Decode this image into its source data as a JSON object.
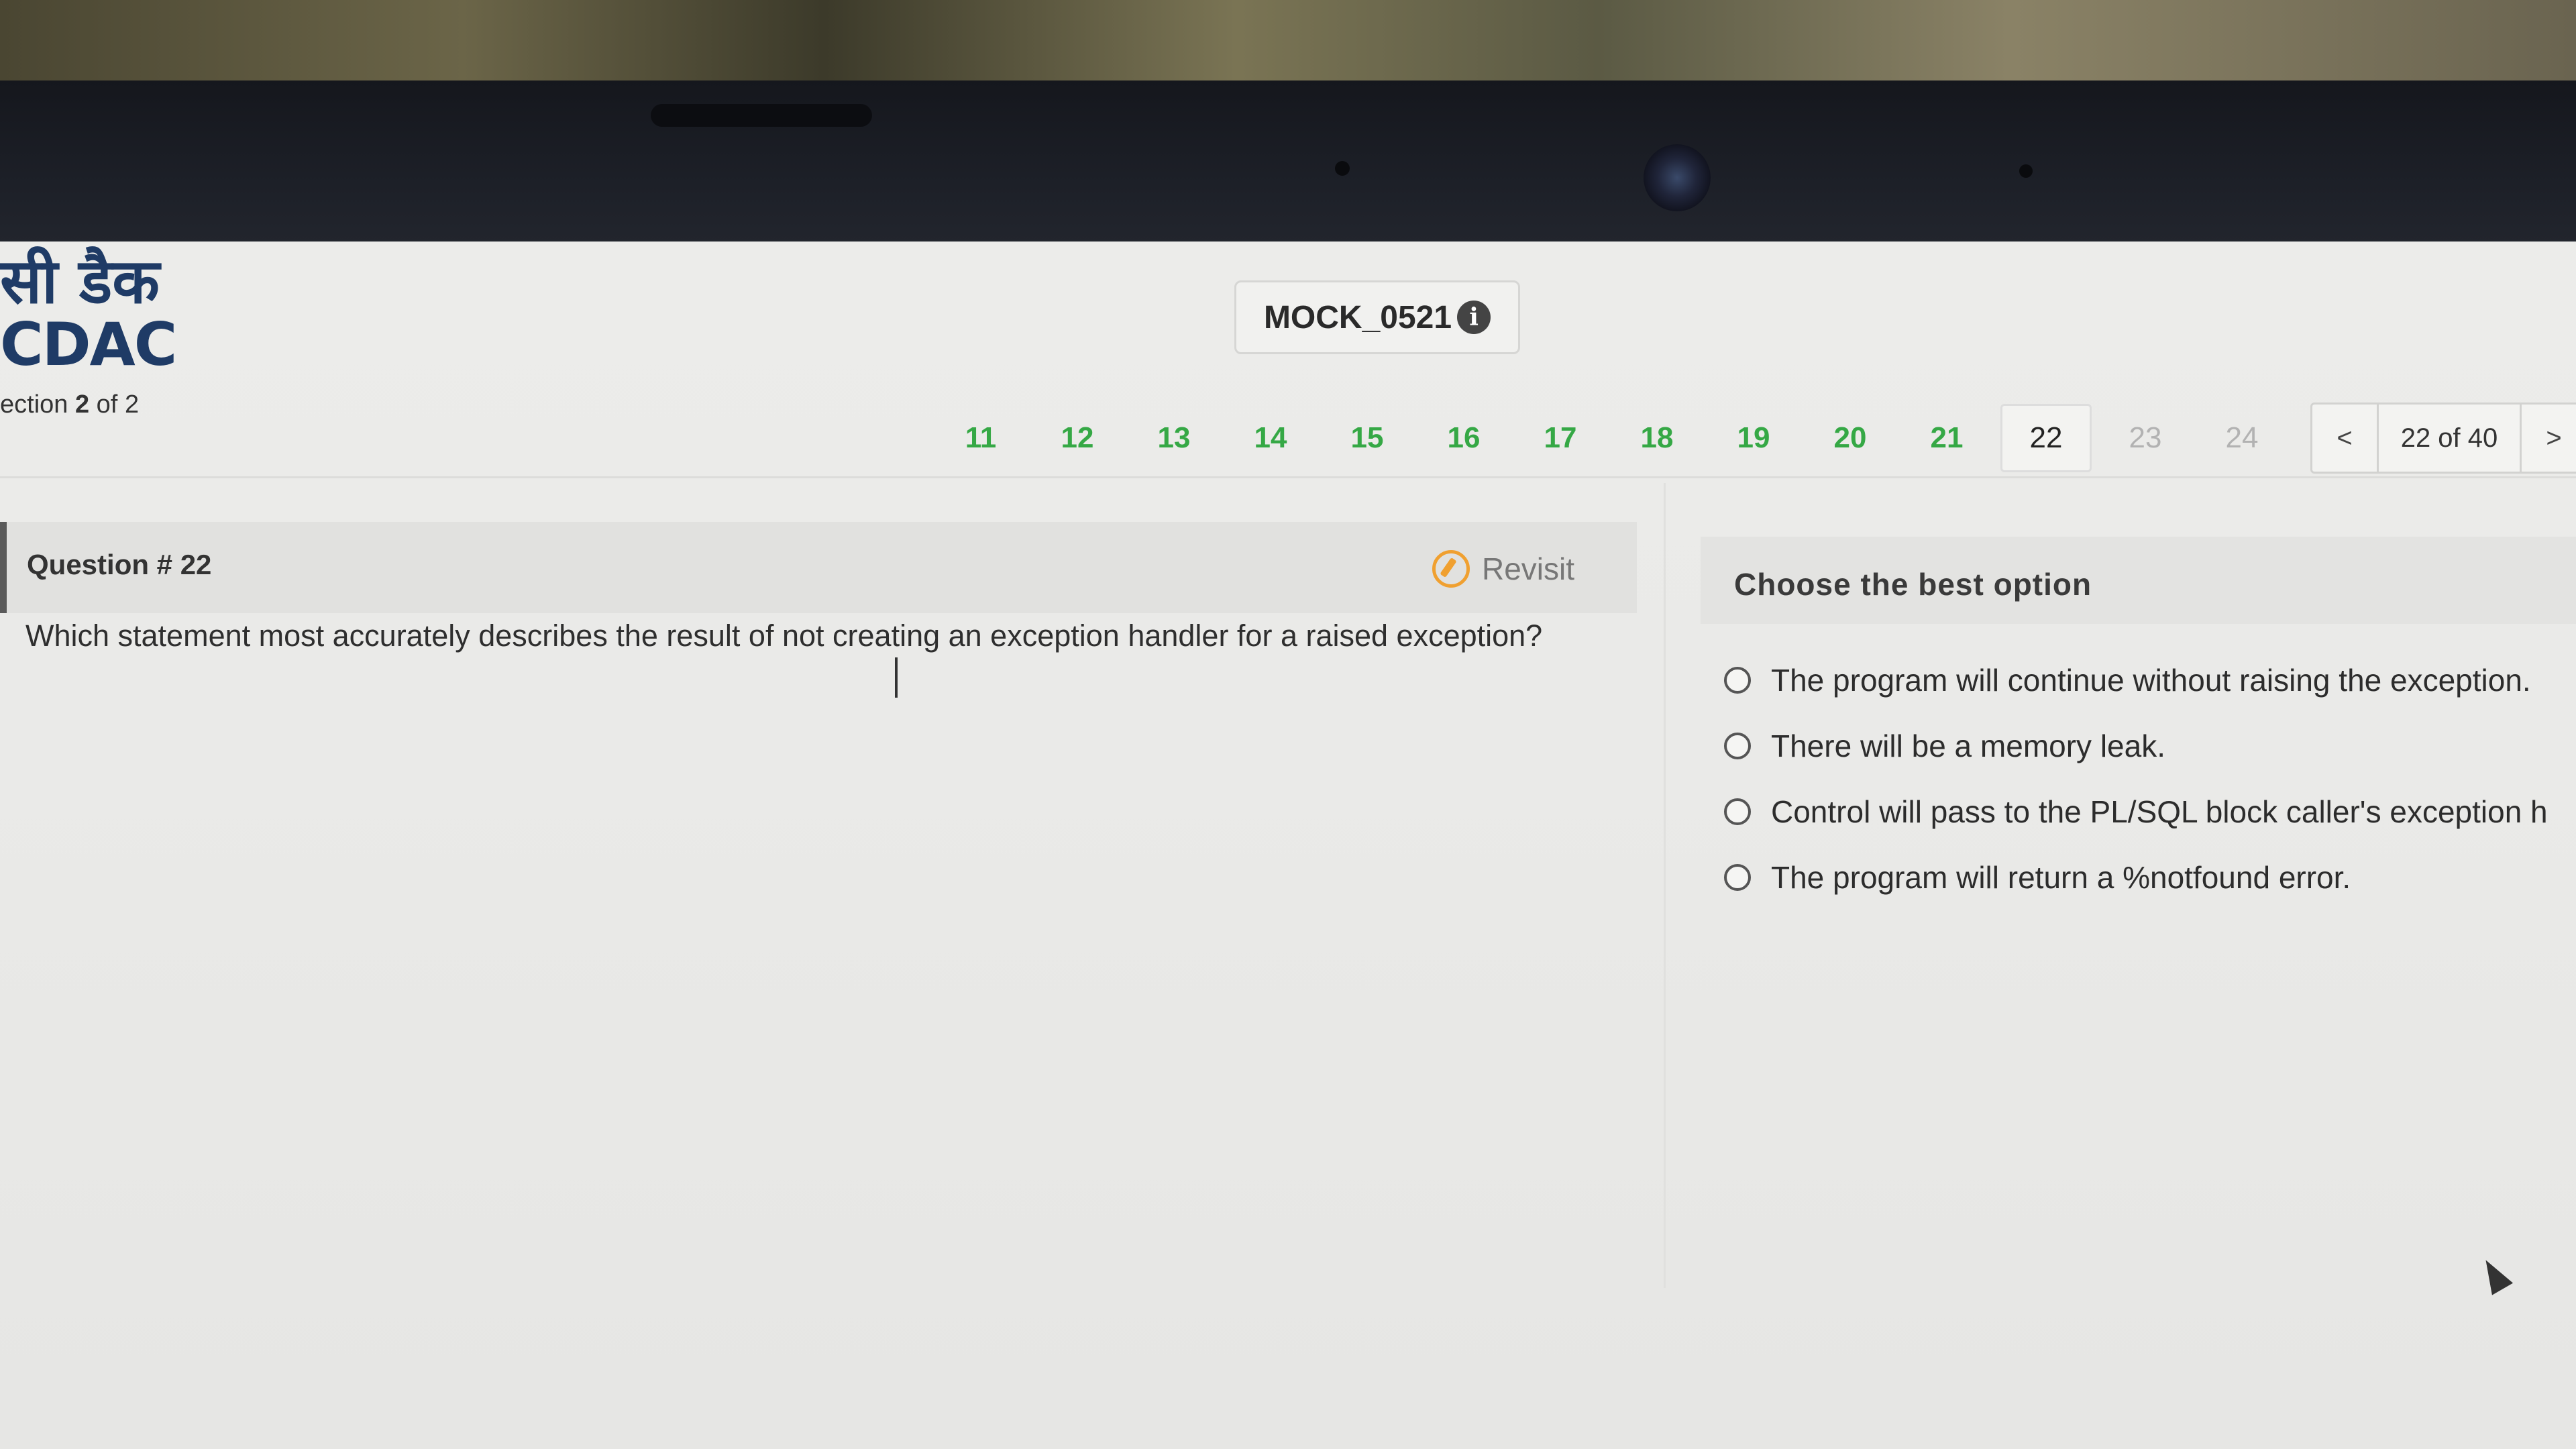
{
  "logo": {
    "hindi": "सी डैक",
    "latin": "CDAC"
  },
  "section": {
    "prefix": "ection",
    "current": "2",
    "separator": "of",
    "total": "2"
  },
  "test": {
    "id": "MOCK_0521",
    "info_icon": "info-icon"
  },
  "question_nav": {
    "answered": [
      "11",
      "12",
      "13",
      "14",
      "15",
      "16",
      "17",
      "18",
      "19",
      "20",
      "21"
    ],
    "current": "22",
    "unvisited": [
      "23",
      "24"
    ]
  },
  "pager": {
    "prev": "<",
    "count": "22 of 40",
    "next": ">"
  },
  "question": {
    "title": "Question # 22",
    "revisit_label": "Revisit",
    "text": "Which statement most accurately describes the result of not creating an exception handler for a raised exception?"
  },
  "options": {
    "header": "Choose the best option",
    "items": [
      "The program will continue without raising the exception.",
      "There will be a memory leak.",
      "Control will pass to the PL/SQL block caller's exception h",
      "The program will return a %notfound error."
    ]
  },
  "colors": {
    "answered": "#35a845",
    "unvisited": "#b2b2b2",
    "revisit": "#f0a030",
    "brand": "#1f3b66"
  }
}
